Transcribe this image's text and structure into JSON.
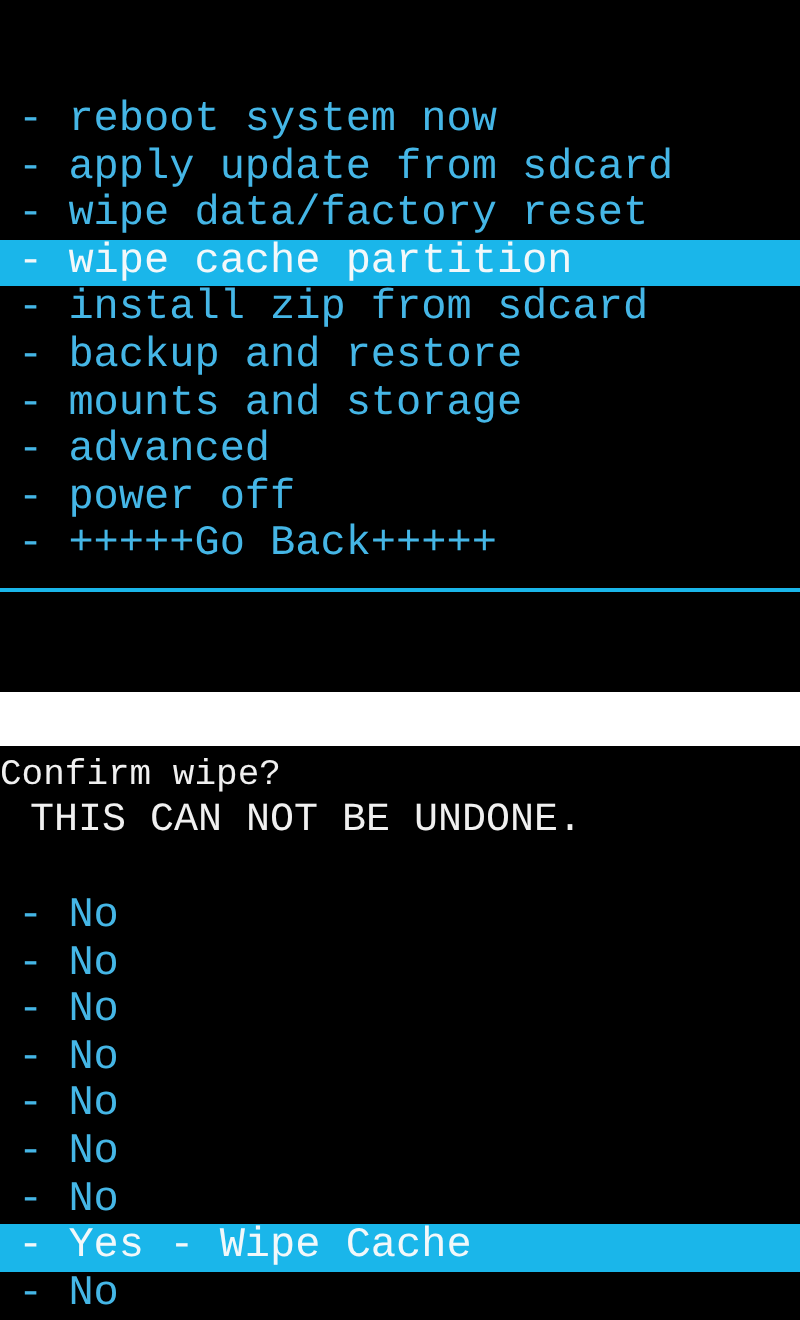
{
  "main_menu": {
    "items": [
      {
        "label": "- reboot system now",
        "selected": false
      },
      {
        "label": "- apply update from sdcard",
        "selected": false
      },
      {
        "label": "- wipe data/factory reset",
        "selected": false
      },
      {
        "label": "- wipe cache partition",
        "selected": true
      },
      {
        "label": "- install zip from sdcard",
        "selected": false
      },
      {
        "label": "- backup and restore",
        "selected": false
      },
      {
        "label": "- mounts and storage",
        "selected": false
      },
      {
        "label": "- advanced",
        "selected": false
      },
      {
        "label": "- power off",
        "selected": false
      },
      {
        "label": "- +++++Go Back+++++",
        "selected": false
      }
    ]
  },
  "confirm_menu": {
    "title": "Confirm wipe?",
    "warning": "  THIS CAN NOT BE UNDONE.",
    "items": [
      {
        "label": "- No",
        "selected": false
      },
      {
        "label": "- No",
        "selected": false
      },
      {
        "label": "- No",
        "selected": false
      },
      {
        "label": "- No",
        "selected": false
      },
      {
        "label": "- No",
        "selected": false
      },
      {
        "label": "- No",
        "selected": false
      },
      {
        "label": "- No",
        "selected": false
      },
      {
        "label": "- Yes - Wipe Cache",
        "selected": true
      },
      {
        "label": "- No",
        "selected": false
      }
    ]
  }
}
